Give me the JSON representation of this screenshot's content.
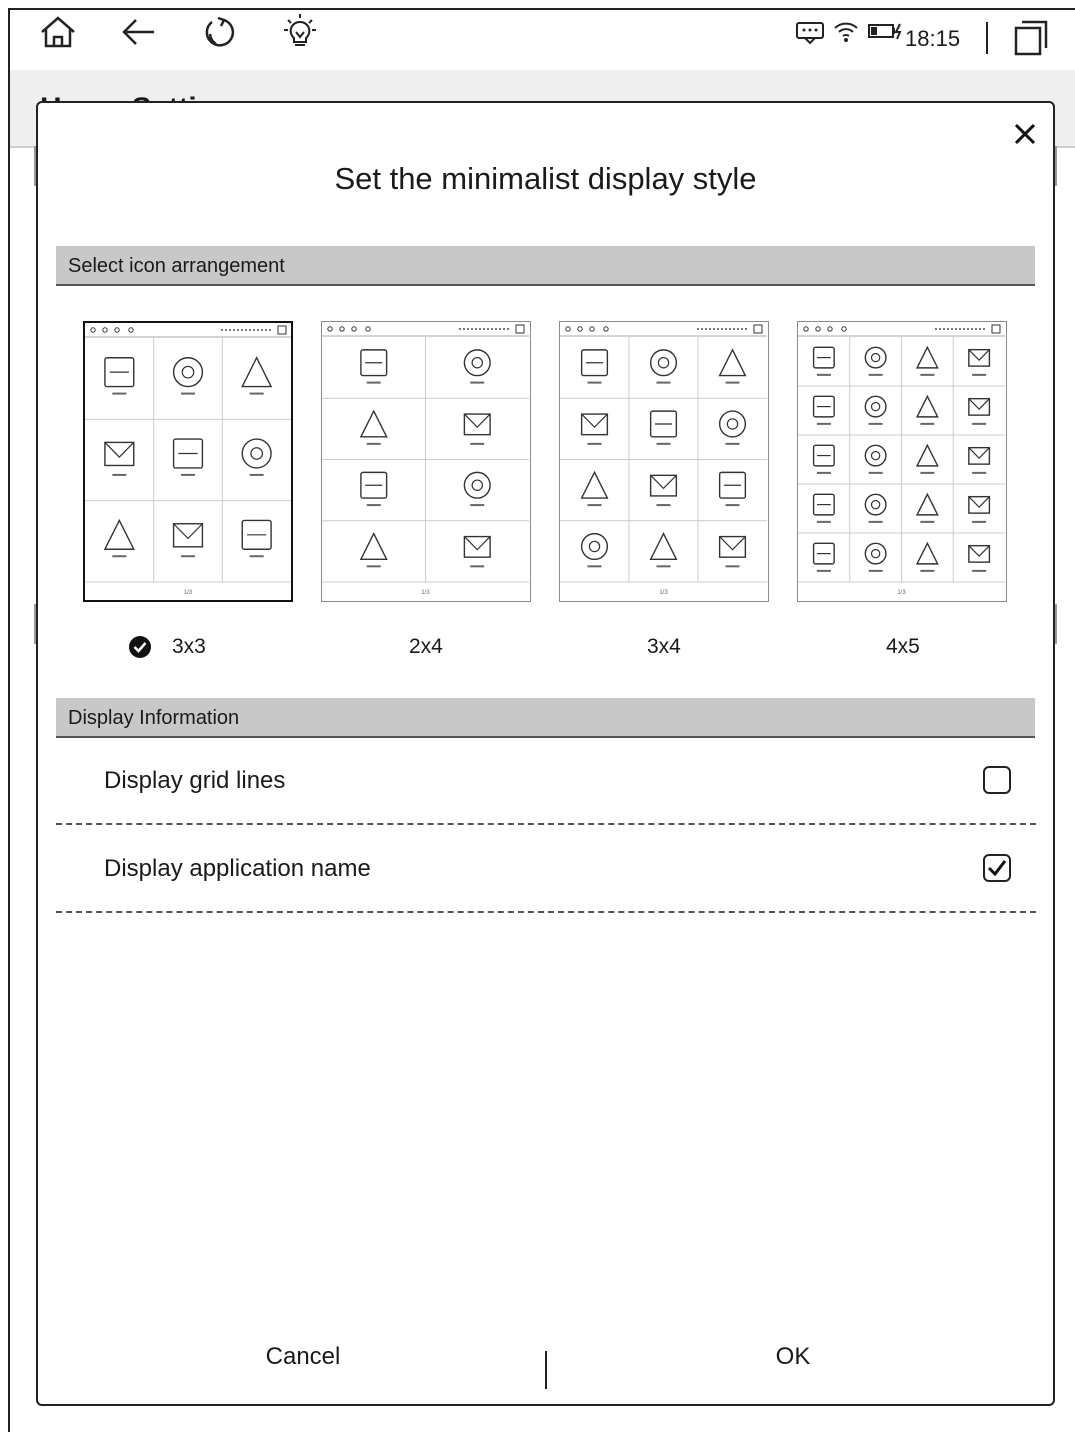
{
  "status_bar": {
    "time": "18:15",
    "left_icons": [
      "home-icon",
      "back-arrow-icon",
      "refresh-icon",
      "lightbulb-icon"
    ],
    "right_icons": [
      "keyboard-icon",
      "wifi-icon",
      "battery-charging-icon",
      "window-switch-icon"
    ]
  },
  "background_page": {
    "title": "Home Settings"
  },
  "dialog": {
    "title": "Set the minimalist display style",
    "arrangement_section": "Select icon arrangement",
    "options": [
      {
        "label": "3x3",
        "selected": true
      },
      {
        "label": "2x4",
        "selected": false
      },
      {
        "label": "3x4",
        "selected": false
      },
      {
        "label": "4x5",
        "selected": false
      }
    ],
    "page_indicator": "1/3",
    "display_section": "Display Information",
    "settings": [
      {
        "label": "Display grid lines",
        "checked": false
      },
      {
        "label": "Display application name",
        "checked": true
      }
    ],
    "cancel_label": "Cancel",
    "ok_label": "OK"
  }
}
